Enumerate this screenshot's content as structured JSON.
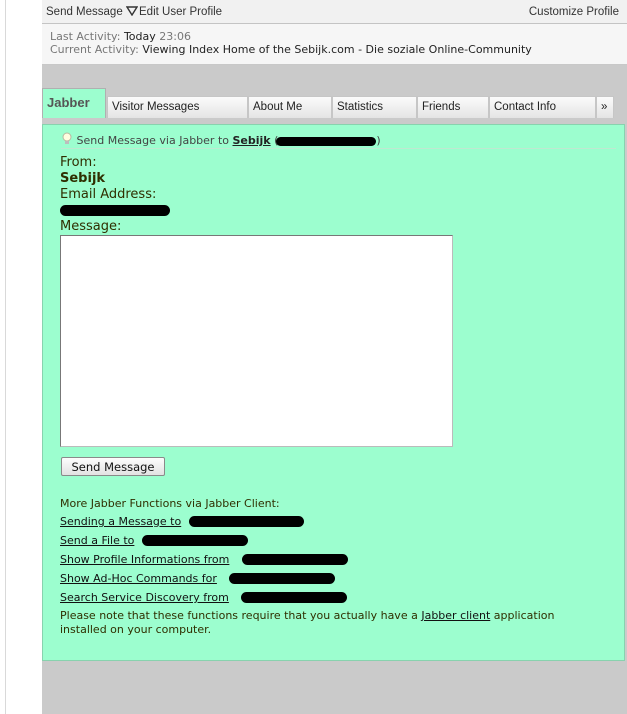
{
  "toolbar": {
    "send_message": "Send Message",
    "edit_profile": "Edit User Profile",
    "customize_profile": "Customize Profile"
  },
  "activity": {
    "last_label": "Last Activity:",
    "last_day": "Today",
    "last_time": "23:06",
    "current_label": "Current Activity:",
    "current_value": "Viewing Index Home of the Sebijk.com - Die soziale Online-Community"
  },
  "tabs": {
    "active": "Jabber",
    "items": [
      "Visitor Messages",
      "About Me",
      "Statistics",
      "Friends",
      "Contact Info",
      "»"
    ]
  },
  "jabber": {
    "hint_prefix": "Send Message via Jabber to",
    "hint_name": "Sebijk",
    "hint_open": "(",
    "hint_close": ")",
    "from_label": "From:",
    "from_value": "Sebijk",
    "email_label": "Email Address:",
    "message_label": "Message:",
    "message_value": "",
    "send_button": "Send Message",
    "more_functions": "More Jabber Functions via Jabber Client:",
    "functions": [
      "Sending a Message to",
      "Send a File to",
      "Show Profile Informations from",
      "Show Ad-Hoc Commands for",
      "Search Service Discovery from"
    ],
    "note_before": "Please note that these functions require that you actually have a",
    "note_link": "Jabber client",
    "note_after": "application installed on your computer."
  },
  "colors": {
    "panel_bg": "#9cfecf",
    "frame_bg": "#cacaca",
    "redaction": "#000000"
  },
  "icons": {
    "dropdown": "triangle-down-outline",
    "hint": "lightbulb"
  }
}
